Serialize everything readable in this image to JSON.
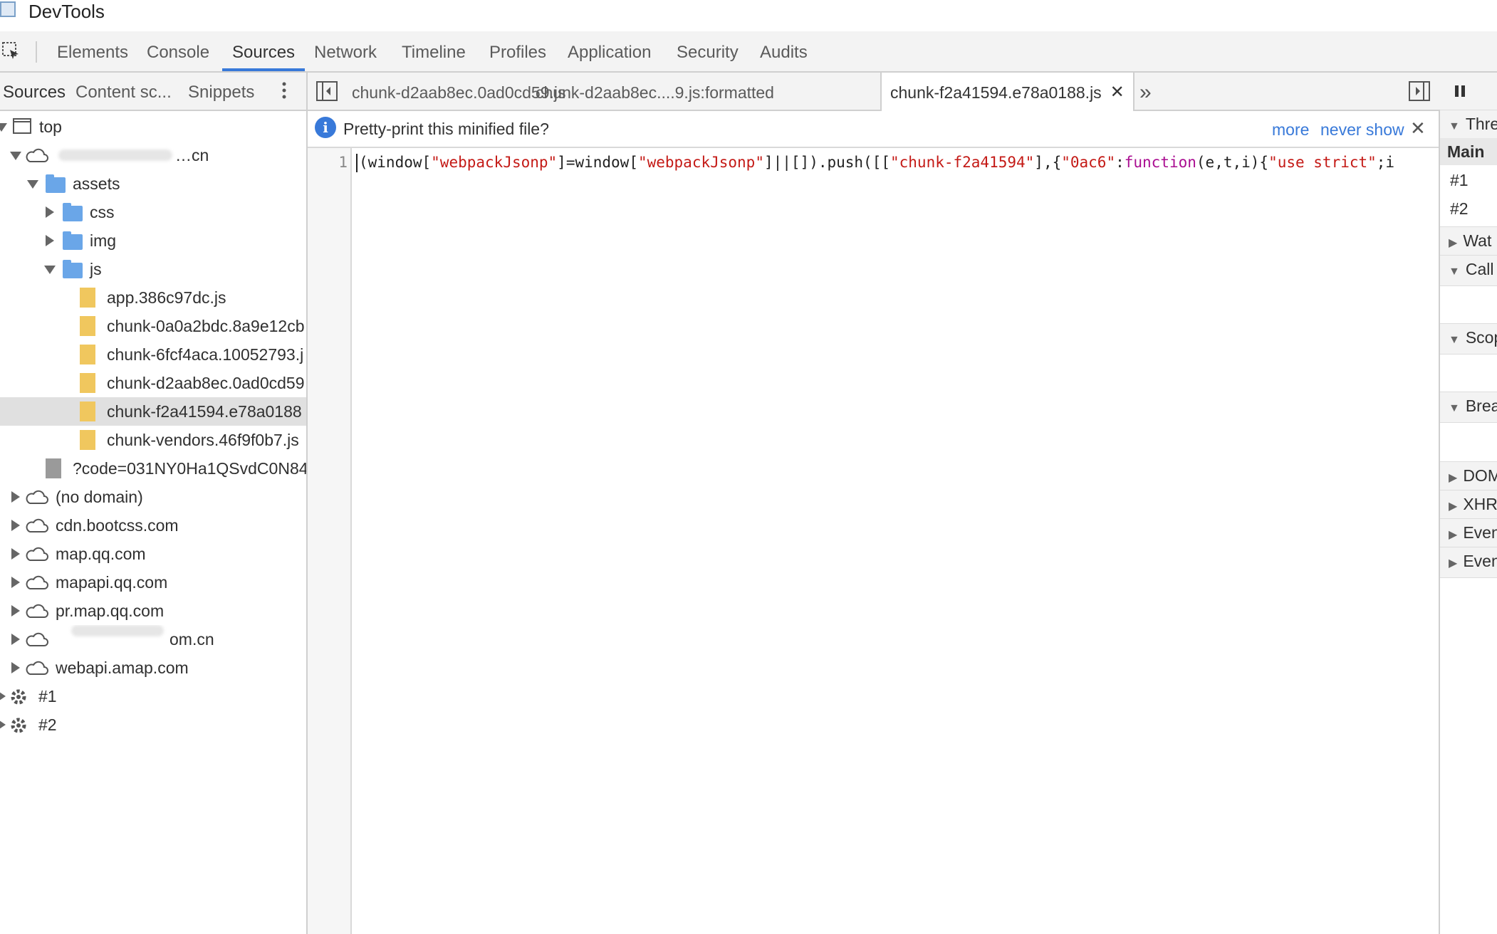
{
  "window": {
    "title": "DevTools"
  },
  "toolbar": {
    "tabs": [
      "Elements",
      "Console",
      "Sources",
      "Network",
      "Timeline",
      "Profiles",
      "Application",
      "Security",
      "Audits"
    ],
    "active": "Sources"
  },
  "navigator": {
    "tabs": [
      "Sources",
      "Content sc...",
      "Snippets"
    ],
    "tree": {
      "top": "top",
      "domain1": "…cn",
      "assets": "assets",
      "css": "css",
      "img": "img",
      "js": "js",
      "files": [
        "app.386c97dc.js",
        "chunk-0a0a2bdc.8a9e12cb",
        "chunk-6fcf4aca.10052793.j",
        "chunk-d2aab8ec.0ad0cd59",
        "chunk-f2a41594.e78a0188",
        "chunk-vendors.46f9f0b7.js"
      ],
      "code_file": "?code=031NY0Ha1QSvdC0N84",
      "domains": [
        "(no domain)",
        "cdn.bootcss.com",
        "map.qq.com",
        "mapapi.qq.com",
        "pr.map.qq.com",
        "om.cn",
        "webapi.amap.com"
      ],
      "workers": [
        "#1",
        "#2"
      ]
    }
  },
  "editor": {
    "tabs": [
      "chunk-d2aab8ec.0ad0cd59.js",
      "chunk-d2aab8ec....9.js:formatted",
      "chunk-f2a41594.e78a0188.js"
    ],
    "active_tab": "chunk-f2a41594.e78a0188.js",
    "infobar": {
      "text": "Pretty-print this minified file?",
      "more": "more",
      "never_show": "never show"
    },
    "line_number": "1",
    "code": {
      "t1": "(window[",
      "s1": "\"webpackJsonp\"",
      "t2": "]=window[",
      "s2": "\"webpackJsonp\"",
      "t3": "]||[]).push([[",
      "s3": "\"chunk-f2a41594\"",
      "t4": "],{",
      "s4": "\"0ac6\"",
      "t5": ":",
      "k1": "function",
      "t6": "(e,t,i){",
      "s5": "\"use strict\"",
      "t7": ";i"
    }
  },
  "debugger": {
    "sections": [
      "Thre",
      "Wat",
      "Call",
      "Scop",
      "Brea",
      "DOM",
      "XHR",
      "Even",
      "Even"
    ],
    "threads": [
      "Main",
      "#1",
      "#2"
    ]
  },
  "colors": {
    "accent": "#3879d9",
    "folder": "#6aa6e8",
    "js_file": "#f0c75e",
    "string": "#c41a16",
    "keyword": "#aa0d91"
  }
}
